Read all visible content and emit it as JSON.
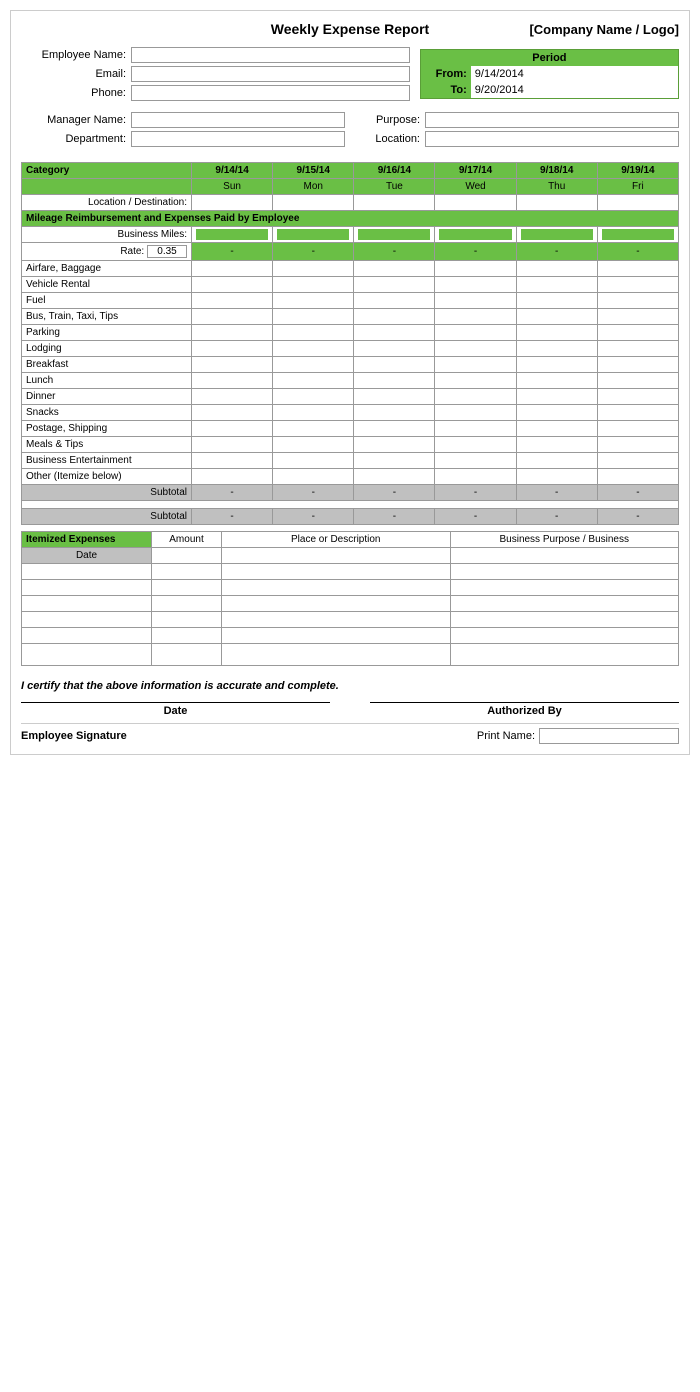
{
  "header": {
    "title": "Weekly Expense Report",
    "company": "[Company Name / Logo]"
  },
  "employee": {
    "name_label": "Employee Name:",
    "email_label": "Email:",
    "phone_label": "Phone:"
  },
  "period": {
    "label": "Period",
    "from_label": "From:",
    "from_value": "9/14/2014",
    "to_label": "To:",
    "to_value": "9/20/2014"
  },
  "manager": {
    "name_label": "Manager Name:",
    "purpose_label": "Purpose:",
    "dept_label": "Department:",
    "location_label": "Location:"
  },
  "table": {
    "category_label": "Category",
    "dates": [
      "9/14/14",
      "9/15/14",
      "9/16/14",
      "9/17/14",
      "9/18/14",
      "9/19/14"
    ],
    "days": [
      "Sun",
      "Mon",
      "Tue",
      "Wed",
      "Thu",
      "Fri"
    ],
    "location_label": "Location / Destination:",
    "mileage_section": "Mileage Reimbursement and Expenses Paid by Employee",
    "business_miles_label": "Business Miles:",
    "rate_label": "Rate:",
    "rate_value": "0.35",
    "dash": "-",
    "categories": [
      "Airfare, Baggage",
      "Vehicle Rental",
      "Fuel",
      "Bus, Train, Taxi, Tips",
      "Parking",
      "Lodging",
      "Breakfast",
      "Lunch",
      "Dinner",
      "Snacks",
      "Postage, Shipping",
      "Meals & Tips",
      "Business Entertainment",
      "Other (Itemize below)"
    ],
    "subtotal_label": "Subtotal",
    "subtotal_values": [
      "-",
      "-",
      "-",
      "-",
      "-",
      "-"
    ]
  },
  "second_subtotal": {
    "label": "Subtotal",
    "values": [
      "-",
      "-",
      "-",
      "-",
      "-",
      "-"
    ]
  },
  "itemized": {
    "header_label": "Itemized Expenses",
    "amount_label": "Amount",
    "place_label": "Place or Description",
    "business_label": "Business Purpose / Business",
    "date_label": "Date",
    "rows": 6
  },
  "certification": {
    "text": "I certify that the above information is accurate and complete."
  },
  "signatures": {
    "date_label": "Date",
    "authorized_label": "Authorized By",
    "emp_sig_label": "Employee Signature",
    "print_name_label": "Print Name:"
  }
}
